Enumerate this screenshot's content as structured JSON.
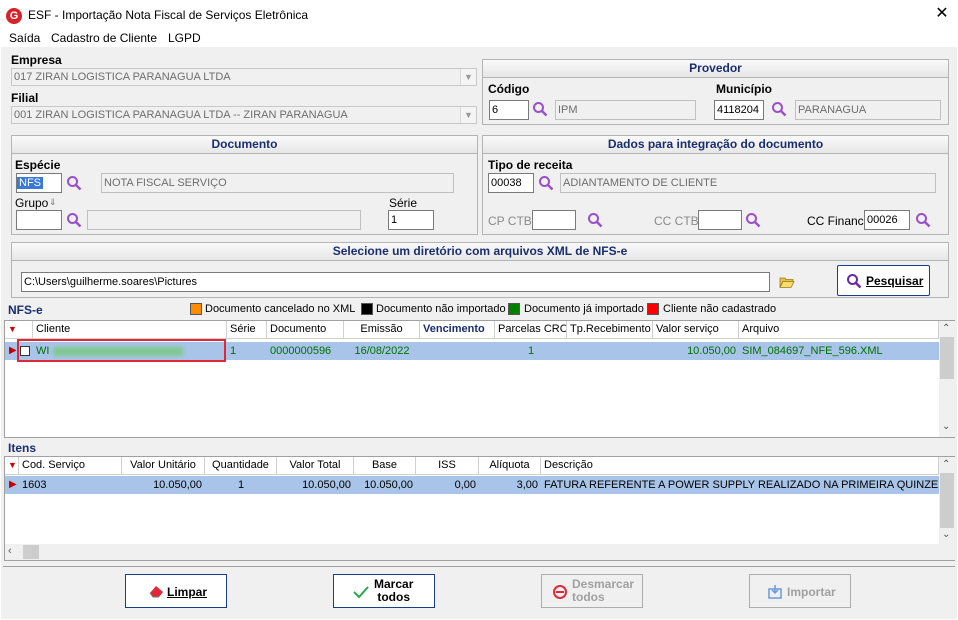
{
  "window": {
    "title": "ESF - Importação Nota Fiscal de Serviços Eletrônica",
    "logo_text": "G"
  },
  "menu": {
    "items": [
      "Saída",
      "Cadastro de Cliente",
      "LGPD"
    ]
  },
  "empresa": {
    "label": "Empresa",
    "value": "017 ZIRAN LOGISTICA PARANAGUA LTDA"
  },
  "filial": {
    "label": "Filial",
    "value": "001 ZIRAN LOGISTICA PARANAGUA LTDA -- ZIRAN PARANAGUA"
  },
  "provedor": {
    "title": "Provedor",
    "codigo_label": "Código",
    "codigo": "6",
    "codigo_desc": "IPM",
    "municipio_label": "Município",
    "municipio": "4118204",
    "municipio_desc": "PARANAGUA"
  },
  "documento": {
    "title": "Documento",
    "especie_label": "Espécie",
    "especie": "NFS",
    "especie_desc": "NOTA FISCAL SERVIÇO",
    "grupo_label": "Grupo",
    "grupo": "",
    "serie_label": "Série",
    "serie": "1"
  },
  "integracao": {
    "title": "Dados para integração do documento",
    "tipo_label": "Tipo de receita",
    "tipo": "00038",
    "tipo_desc": "ADIANTAMENTO DE CLIENTE",
    "cp_label": "CP CTB",
    "cc_label": "CC CTB",
    "ccfin_label": "CC Financ.",
    "ccfin": "00026"
  },
  "diretorio": {
    "title": "Selecione um diretório com arquivos XML de NFS-e",
    "path": "C:\\Users\\guilherme.soares\\Pictures",
    "search_label": "Pesquisar"
  },
  "legend": {
    "section": "NFS-e",
    "items": [
      {
        "label": "Documento cancelado no XML",
        "color": "#ff8c00"
      },
      {
        "label": "Documento não importado",
        "color": "#000000"
      },
      {
        "label": "Documento já importado",
        "color": "#008000"
      },
      {
        "label": "Cliente não cadastrado",
        "color": "#ff0000"
      }
    ]
  },
  "nfse_grid": {
    "columns": [
      "Cliente",
      "Série",
      "Documento",
      "Emissão",
      "Vencimento",
      "Parcelas CRC",
      "Tp.Recebimento",
      "Valor serviço",
      "Arquivo"
    ],
    "row": {
      "cliente": "WI",
      "serie": "1",
      "documento": "0000000596",
      "emissao": "16/08/2022",
      "vencimento": "",
      "parcelas": "1",
      "tp": "",
      "valor": "10.050,00",
      "arquivo": "SIM_084697_NFE_596.XML"
    }
  },
  "itens": {
    "section": "Itens",
    "columns": [
      "Cod. Serviço",
      "Valor Unitário",
      "Quantidade",
      "Valor Total",
      "Base",
      "ISS",
      "Alíquota",
      "Descrição"
    ],
    "row": {
      "cod": "1603",
      "unit": "10.050,00",
      "qtd": "1",
      "total": "10.050,00",
      "base": "10.050,00",
      "iss": "0,00",
      "aliquota": "3,00",
      "descricao": "FATURA REFERENTE A POWER SUPPLY REALIZADO NA PRIMEIRA QUINZENA"
    }
  },
  "buttons": {
    "limpar": "Limpar",
    "marcar_1": "Marcar",
    "marcar_2": "todos",
    "desmarcar_1": "Desmarcar",
    "desmarcar_2": "todos",
    "importar": "Importar"
  }
}
